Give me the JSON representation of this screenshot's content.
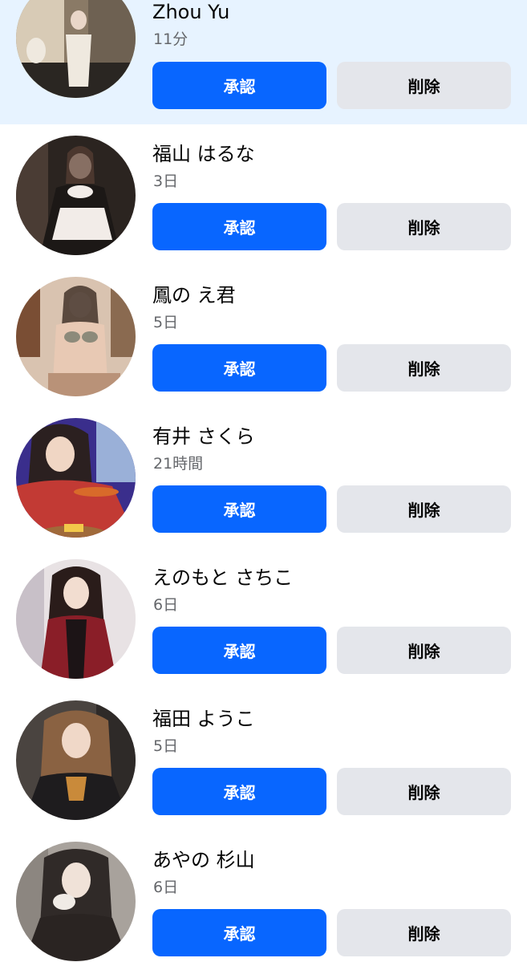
{
  "requests": [
    {
      "name": "Zhou Yu",
      "time": "11分",
      "confirm_label": "承認",
      "delete_label": "削除",
      "highlighted": true,
      "avatar_colors": [
        "#8a7a66",
        "#2a2622",
        "#efe9df"
      ]
    },
    {
      "name": "福山 はるな",
      "time": "3日",
      "confirm_label": "承認",
      "delete_label": "削除",
      "highlighted": false,
      "avatar_colors": [
        "#2b2420",
        "#1c1816",
        "#f2ece8"
      ]
    },
    {
      "name": "鳳の え君",
      "time": "5日",
      "confirm_label": "承認",
      "delete_label": "削除",
      "highlighted": false,
      "avatar_colors": [
        "#d9c3b0",
        "#b99278",
        "#8c8a7a"
      ]
    },
    {
      "name": "有井 さくら",
      "time": "21時間",
      "confirm_label": "承認",
      "delete_label": "削除",
      "highlighted": false,
      "avatar_colors": [
        "#3a2e8c",
        "#c23a34",
        "#2b2020"
      ]
    },
    {
      "name": "えのもと さちこ",
      "time": "6日",
      "confirm_label": "承認",
      "delete_label": "削除",
      "highlighted": false,
      "avatar_colors": [
        "#e8e2e4",
        "#8a1e28",
        "#2a1c1a"
      ]
    },
    {
      "name": "福田 ようこ",
      "time": "5日",
      "confirm_label": "承認",
      "delete_label": "削除",
      "highlighted": false,
      "avatar_colors": [
        "#4a4440",
        "#1e1c1e",
        "#c98a3a"
      ]
    },
    {
      "name": "あやの 杉山",
      "time": "6日",
      "confirm_label": "承認",
      "delete_label": "削除",
      "highlighted": false,
      "avatar_colors": [
        "#a8a29c",
        "#302a28",
        "#f0ebe6"
      ]
    }
  ],
  "colors": {
    "confirm": "#0866ff",
    "delete": "#e4e6eb",
    "highlight_row": "#e7f3ff"
  }
}
